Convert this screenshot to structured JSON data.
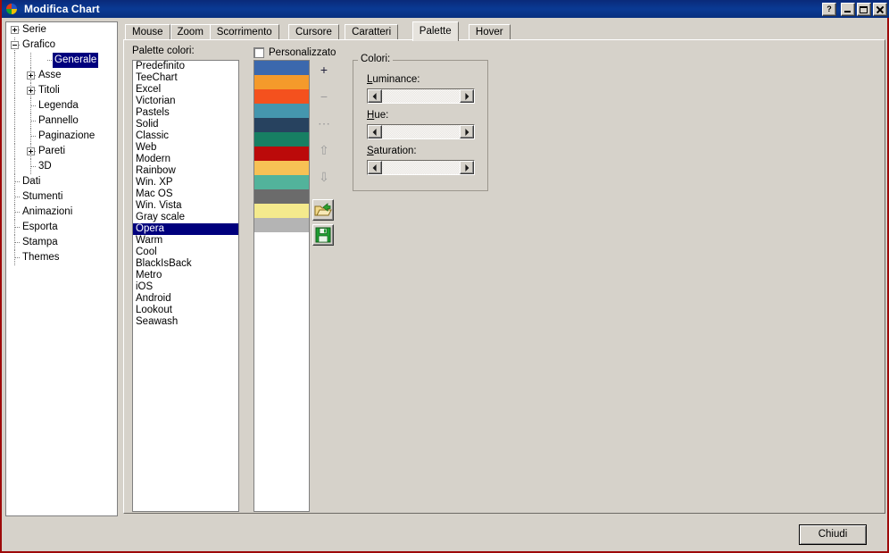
{
  "window": {
    "title": "Modifica Chart",
    "icon": "teechart-logo-icon",
    "buttons": {
      "help": "?",
      "minimize": "minimize-icon",
      "maximize": "maximize-icon",
      "close": "close-icon"
    }
  },
  "tree": {
    "nodes": [
      {
        "label": "Serie",
        "depth": 0,
        "toggle": "plus",
        "selected": false
      },
      {
        "label": "Grafico",
        "depth": 0,
        "toggle": "minus",
        "selected": false
      },
      {
        "label": "Generale",
        "depth": 2,
        "toggle": "none",
        "selected": true
      },
      {
        "label": "Asse",
        "depth": 1,
        "toggle": "plus",
        "selected": false
      },
      {
        "label": "Titoli",
        "depth": 1,
        "toggle": "plus",
        "selected": false
      },
      {
        "label": "Legenda",
        "depth": 1,
        "toggle": "none",
        "selected": false
      },
      {
        "label": "Pannello",
        "depth": 1,
        "toggle": "none",
        "selected": false
      },
      {
        "label": "Paginazione",
        "depth": 1,
        "toggle": "none",
        "selected": false
      },
      {
        "label": "Pareti",
        "depth": 1,
        "toggle": "plus",
        "selected": false
      },
      {
        "label": "3D",
        "depth": 1,
        "toggle": "none",
        "selected": false
      },
      {
        "label": "Dati",
        "depth": 0,
        "toggle": "none",
        "selected": false
      },
      {
        "label": "Stumenti",
        "depth": 0,
        "toggle": "none",
        "selected": false
      },
      {
        "label": "Animazioni",
        "depth": 0,
        "toggle": "none",
        "selected": false
      },
      {
        "label": "Esporta",
        "depth": 0,
        "toggle": "none",
        "selected": false
      },
      {
        "label": "Stampa",
        "depth": 0,
        "toggle": "none",
        "selected": false
      },
      {
        "label": "Themes",
        "depth": 0,
        "toggle": "none",
        "selected": false
      }
    ]
  },
  "tabs": [
    {
      "label": "Mouse",
      "active": false
    },
    {
      "label": "Zoom",
      "active": false
    },
    {
      "label": "Scorrimento",
      "active": false
    },
    {
      "label": "Cursore",
      "active": false
    },
    {
      "label": "Caratteri",
      "active": false
    },
    {
      "label": "Palette",
      "active": true
    },
    {
      "label": "Hover",
      "active": false
    }
  ],
  "palette_panel": {
    "list_label": "Palette colori:",
    "custom_checkbox_label": "Personalizzato",
    "custom_checked": false,
    "items": [
      "Predefinito",
      "TeeChart",
      "Excel",
      "Victorian",
      "Pastels",
      "Solid",
      "Classic",
      "Web",
      "Modern",
      "Rainbow",
      "Win. XP",
      "Mac OS",
      "Win. Vista",
      "Gray scale",
      "Opera",
      "Warm",
      "Cool",
      "BlackIsBack",
      "Metro",
      "iOS",
      "Android",
      "Lookout",
      "Seawash"
    ],
    "selected_item": "Opera",
    "swatches": [
      "#3b68ad",
      "#f49a2b",
      "#f4511e",
      "#4596ae",
      "#27425f",
      "#177f63",
      "#bb0a0a",
      "#f7c155",
      "#52b39b",
      "#6b6b6b",
      "#f4ea8d",
      "#b4b4b4"
    ],
    "tools": [
      {
        "name": "add-color-button",
        "glyph": "+",
        "enabled": true
      },
      {
        "name": "remove-color-button",
        "glyph": "−",
        "enabled": false
      },
      {
        "name": "more-options-button",
        "glyph": "⋯",
        "enabled": false
      },
      {
        "name": "move-up-button",
        "glyph": "⇧",
        "enabled": false
      },
      {
        "name": "move-down-button",
        "glyph": "⇩",
        "enabled": false
      },
      {
        "name": "open-palette-button",
        "glyph": "open-folder-icon",
        "enabled": true
      },
      {
        "name": "save-palette-button",
        "glyph": "save-disk-icon",
        "enabled": true
      }
    ]
  },
  "colori_group": {
    "legend": "Colori:",
    "sliders": [
      {
        "label": "Luminance:",
        "accel": "L"
      },
      {
        "label": "Hue:",
        "accel": "H"
      },
      {
        "label": "Saturation:",
        "accel": "S"
      }
    ]
  },
  "footer": {
    "close_label": "Chiudi"
  },
  "colors": {
    "titlebar": "#0a3a94",
    "face": "#d6d2ca",
    "selection": "#00007d",
    "window_border": "#9d0a0a"
  }
}
